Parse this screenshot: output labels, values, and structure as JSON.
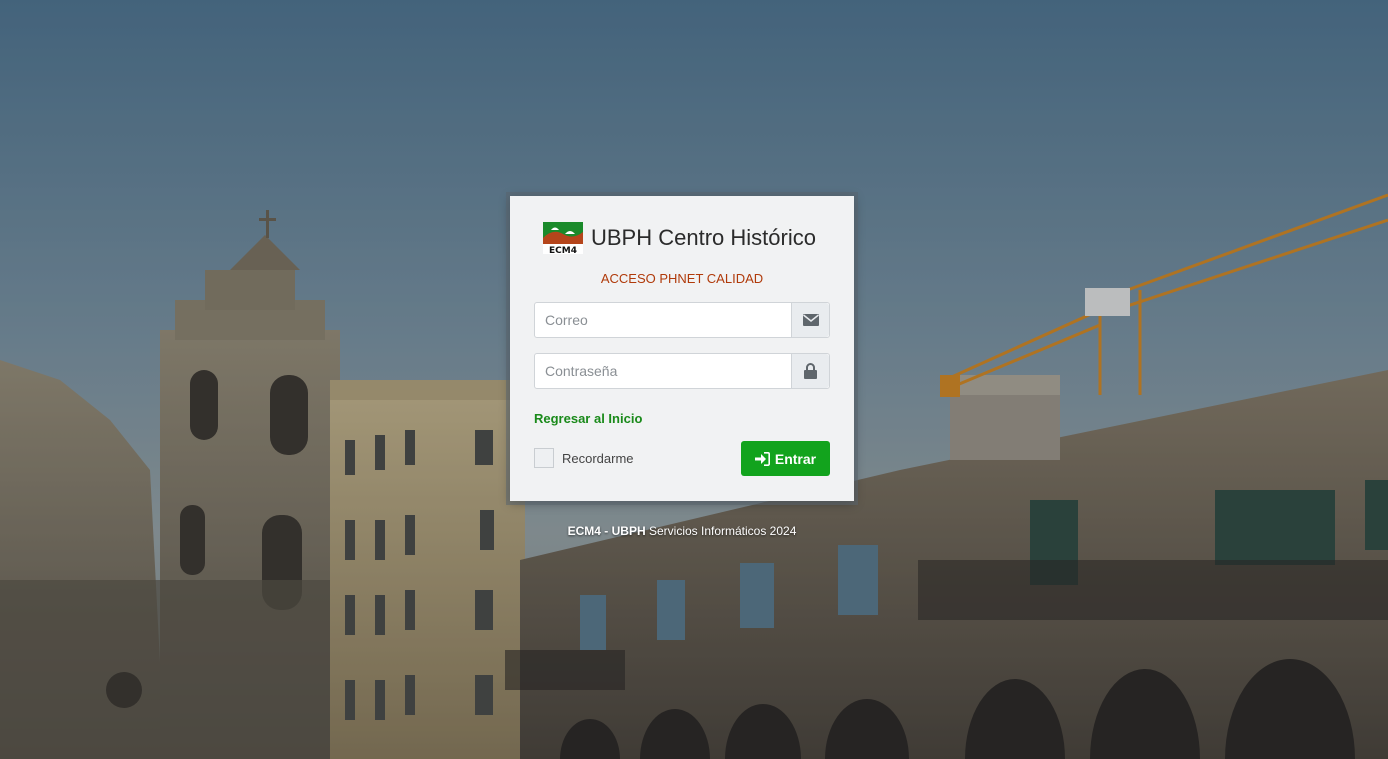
{
  "brand": {
    "logo_text": "ECM4",
    "title": "UBPH Centro Histórico"
  },
  "subtitle": "ACCESO PHNET CALIDAD",
  "form": {
    "email_placeholder": "Correo",
    "email_icon": "envelope-icon",
    "password_placeholder": "Contraseña",
    "password_icon": "lock-icon",
    "back_link": "Regresar al Inicio",
    "remember_label": "Recordarme",
    "submit_label": "Entrar",
    "submit_icon": "sign-in-icon"
  },
  "footer": {
    "org1": "ECM4",
    "separator": " - ",
    "org2": "UBPH",
    "text": " Servicios Informáticos 2024"
  },
  "colors": {
    "accent_green": "#12a31d",
    "link_green": "#1a8a1a",
    "subtitle_red": "#b03a0a",
    "card_bg": "#f1f2f3"
  }
}
